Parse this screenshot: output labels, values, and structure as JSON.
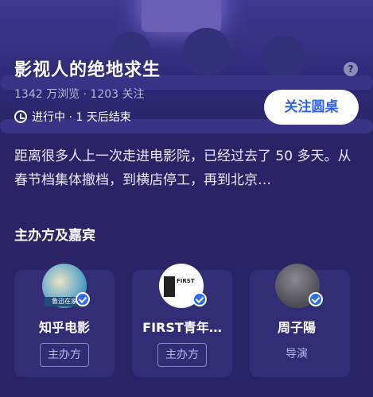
{
  "header": {
    "title": "影视人的绝地求生",
    "stats": "1342 万浏览 · 1203 关注",
    "status": "进行中 · 1 天后结束",
    "follow_label": "关注圆桌",
    "help_icon": "question-icon"
  },
  "description": "距离很多人上一次走进电影院，已经过去了 50 多天。从春节档集体撤档，到横店停工，再到北京…",
  "guests": {
    "section_title": "主办方及嘉宾",
    "items": [
      {
        "name": "知乎电影",
        "role": "主办方",
        "avatar_text": "鲁迅在家"
      },
      {
        "name": "FIRST青年…",
        "role": "主办方",
        "avatar_text": "FIRST"
      },
      {
        "name": "周子陽",
        "role": "导演",
        "avatar_text": ""
      }
    ]
  },
  "colors": {
    "background": "#2a2466",
    "accent": "#2f64e8",
    "verified": "#2f6cf0"
  }
}
